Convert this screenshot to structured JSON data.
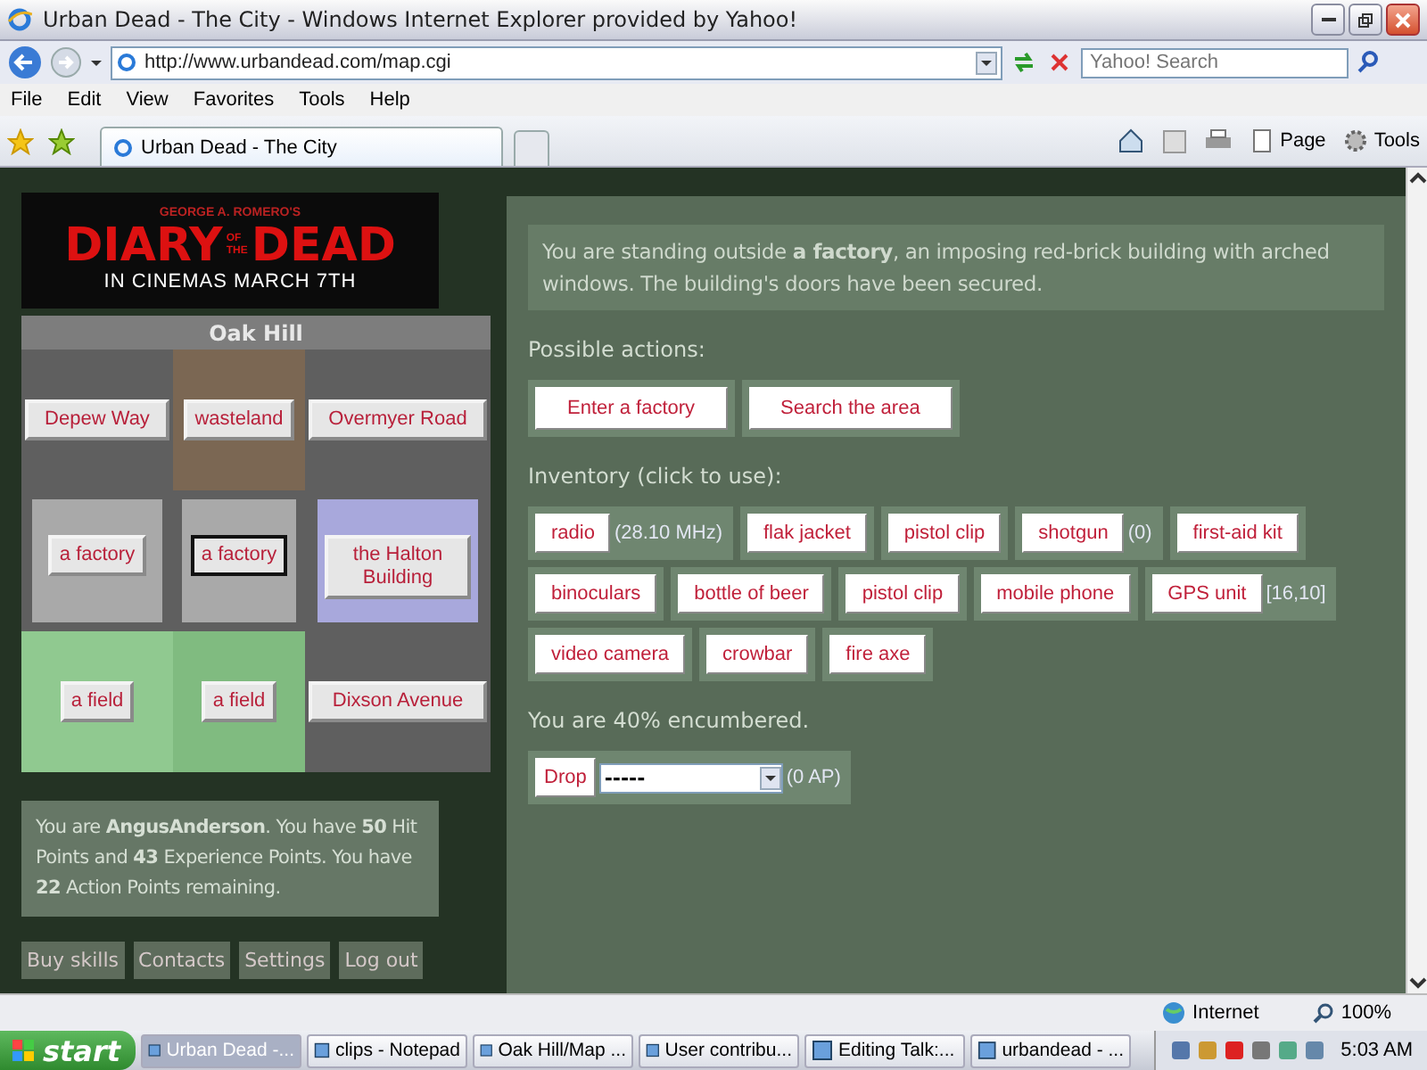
{
  "window": {
    "title": "Urban Dead - The City - Windows Internet Explorer provided by Yahoo!"
  },
  "address_bar": {
    "url": "http://www.urbandead.com/map.cgi"
  },
  "search": {
    "placeholder": "Yahoo! Search"
  },
  "menu": [
    "File",
    "Edit",
    "View",
    "Favorites",
    "Tools",
    "Help"
  ],
  "tabs": [
    {
      "label": "Urban Dead - The City",
      "selected": true
    }
  ],
  "command_bar": [
    "Page",
    "Tools"
  ],
  "banner": {
    "byline": "GEORGE A. ROMERO'S",
    "title_1": "DIARY",
    "title_small": "OF THE",
    "title_2": "DEAD",
    "tagline": "IN CINEMAS MARCH 7TH"
  },
  "map": {
    "title": "Oak Hill",
    "cells": [
      {
        "label": "Depew Way",
        "kind": "street",
        "color": "#5f5f5f",
        "selected": false
      },
      {
        "label": "wasteland",
        "kind": "open",
        "color": "#7b6753",
        "selected": false
      },
      {
        "label": "Overmyer Road",
        "kind": "street",
        "color": "#5f5f5f",
        "selected": false
      },
      {
        "label": "a factory",
        "kind": "building",
        "color": "#a9a9a9",
        "selected": false
      },
      {
        "label": "a factory",
        "kind": "building",
        "color": "#a9a9a9",
        "selected": true
      },
      {
        "label": "the Halton Building",
        "kind": "building",
        "color": "#a8a8dc",
        "selected": false
      },
      {
        "label": "a field",
        "kind": "open",
        "color": "#90c990",
        "selected": false
      },
      {
        "label": "a field",
        "kind": "open",
        "color": "#80bb80",
        "selected": false
      },
      {
        "label": "Dixson Avenue",
        "kind": "street",
        "color": "#5f5f5f",
        "selected": false
      }
    ]
  },
  "player": "You are **AngusAnderson**. You have **50** Hit Points and **43** Experience Points. You have **22** Action Points remaining.",
  "links": [
    "Buy skills",
    "Contacts",
    "Settings",
    "Log out"
  ],
  "description": "You are standing outside **a factory**, an imposing red-brick building with arched windows. The building's doors have been secured.",
  "actions_label": "Possible actions:",
  "actions": [
    "Enter a factory",
    "Search the area"
  ],
  "inventory_label": "Inventory (click to use):",
  "inventory_rows": [
    [
      {
        "label": "radio",
        "note": "(28.10 MHz)"
      },
      {
        "label": "flak jacket"
      },
      {
        "label": "pistol clip"
      },
      {
        "label": "shotgun",
        "note": "(0)"
      },
      {
        "label": "first-aid kit"
      }
    ],
    [
      {
        "label": "binoculars"
      },
      {
        "label": "bottle of beer"
      },
      {
        "label": "pistol clip"
      },
      {
        "label": "mobile phone"
      },
      {
        "label": "GPS unit",
        "note": "[16,10]"
      }
    ],
    [
      {
        "label": "video camera"
      },
      {
        "label": "crowbar"
      },
      {
        "label": "fire axe"
      }
    ]
  ],
  "encumbrance": "You are 40% encumbered.",
  "drop": {
    "button": "Drop",
    "value": "-----",
    "note": "(0 AP)"
  },
  "status_bar": {
    "zone": "Internet",
    "zoom": "100%"
  },
  "taskbar": {
    "start": "start",
    "clock": "5:03 AM",
    "tasks": [
      {
        "label": "Urban Dead -...",
        "selected": true
      },
      {
        "label": "clips - Notepad",
        "selected": false
      },
      {
        "label": "Oak Hill/Map ...",
        "selected": false
      },
      {
        "label": "User contribu...",
        "selected": false
      },
      {
        "label": "Editing Talk:...",
        "selected": false
      },
      {
        "label": "urbandead - ...",
        "selected": false
      }
    ]
  }
}
